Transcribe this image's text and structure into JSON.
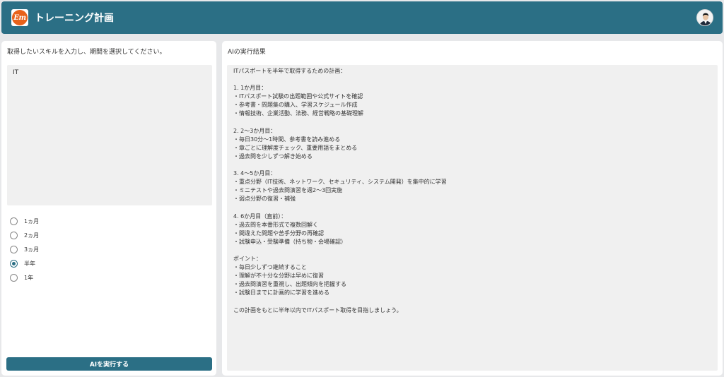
{
  "header": {
    "logo_text": "Em",
    "title": "トレーニング計画"
  },
  "left": {
    "instruction": "取得したいスキルを入力し、期間を選択してください。",
    "skill_value": "IT",
    "periods": [
      {
        "label": "1ヵ月",
        "checked": false
      },
      {
        "label": "2ヵ月",
        "checked": false
      },
      {
        "label": "3ヵ月",
        "checked": false
      },
      {
        "label": "半年",
        "checked": true
      },
      {
        "label": "1年",
        "checked": false
      }
    ],
    "run_button": "AIを実行する"
  },
  "right": {
    "label": "AIの実行結果",
    "result": "ITパスポートを半年で取得するための計画：\n\n1. 1か月目：\n・ITパスポート試験の出題範囲や公式サイトを確認\n・参考書・問題集の購入、学習スケジュール作成\n・情報技術、企業活動、法務、経営戦略の基礎理解\n\n2. 2〜3か月目：\n・毎日30分〜1時間、参考書を読み進める\n・章ごとに理解度チェック、重要用語をまとめる\n・過去問を少しずつ解き始める\n\n3. 4〜5か月目：\n・重点分野（IT技術、ネットワーク、セキュリティ、システム開発）を集中的に学習\n・ミニテストや過去問演習を週2〜3回実施\n・弱点分野の復習・補強\n\n4. 6か月目（直前）：\n・過去問を本番形式で複数回解く\n・間違えた問題や苦手分野の再確認\n・試験申込・受験準備（持ち物・会場確認）\n\nポイント：\n・毎日少しずつ継続すること\n・理解が不十分な分野は早めに復習\n・過去問演習を重視し、出題傾向を把握する\n・試験日までに計画的に学習を進める\n\nこの計画をもとに半年以内でITパスポート取得を目指しましょう。"
  },
  "colors": {
    "header_bg": "#2b6f85",
    "logo_bg": "#e8621a",
    "button_bg": "#2b6f85"
  }
}
